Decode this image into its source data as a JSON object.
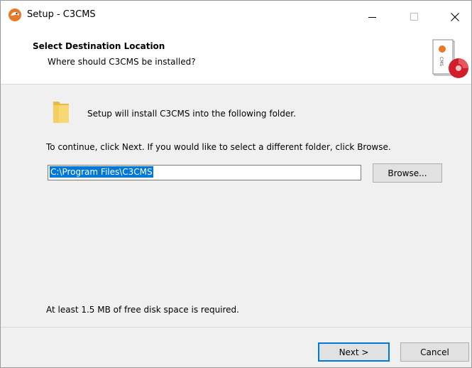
{
  "window": {
    "title": "Setup - C3CMS",
    "controls": {
      "minimize": "—",
      "maximize": "☐",
      "close": "✕"
    }
  },
  "header": {
    "title": "Select Destination Location",
    "subtitle": "Where should C3CMS be installed?",
    "logo_icon": "c3cms-box-icon"
  },
  "body": {
    "install_text": "Setup will install C3CMS into the following folder.",
    "continue_text": "To continue, click Next. If you would like to select a different folder, click Browse.",
    "path_value": "C:\\Program Files\\C3CMS",
    "browse_label": "Browse...",
    "disk_space_text": "At least 1.5 MB of free disk space is required."
  },
  "footer": {
    "next_label": "Next >",
    "cancel_label": "Cancel"
  },
  "colors": {
    "selection": "#0078d7",
    "button_bg": "#e1e1e1",
    "panel_bg": "#f0f0f0"
  }
}
